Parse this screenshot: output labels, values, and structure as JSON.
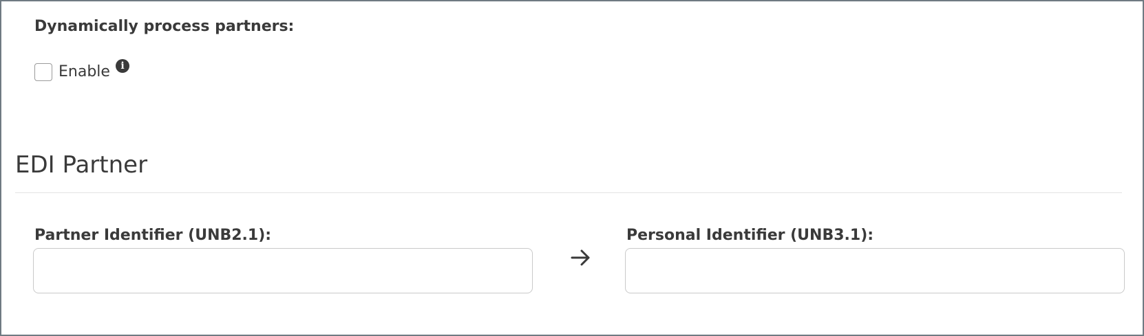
{
  "dynamic": {
    "label": "Dynamically process partners:",
    "enable_label": "Enable",
    "enable_checked": false,
    "info_icon": "info-icon"
  },
  "edi_partner": {
    "title": "EDI Partner",
    "partner_identifier": {
      "label": "Partner Identifier (UNB2.1):",
      "value": ""
    },
    "arrow_icon": "arrow-right-icon",
    "personal_identifier": {
      "label": "Personal Identifier (UNB3.1):",
      "value": ""
    }
  }
}
